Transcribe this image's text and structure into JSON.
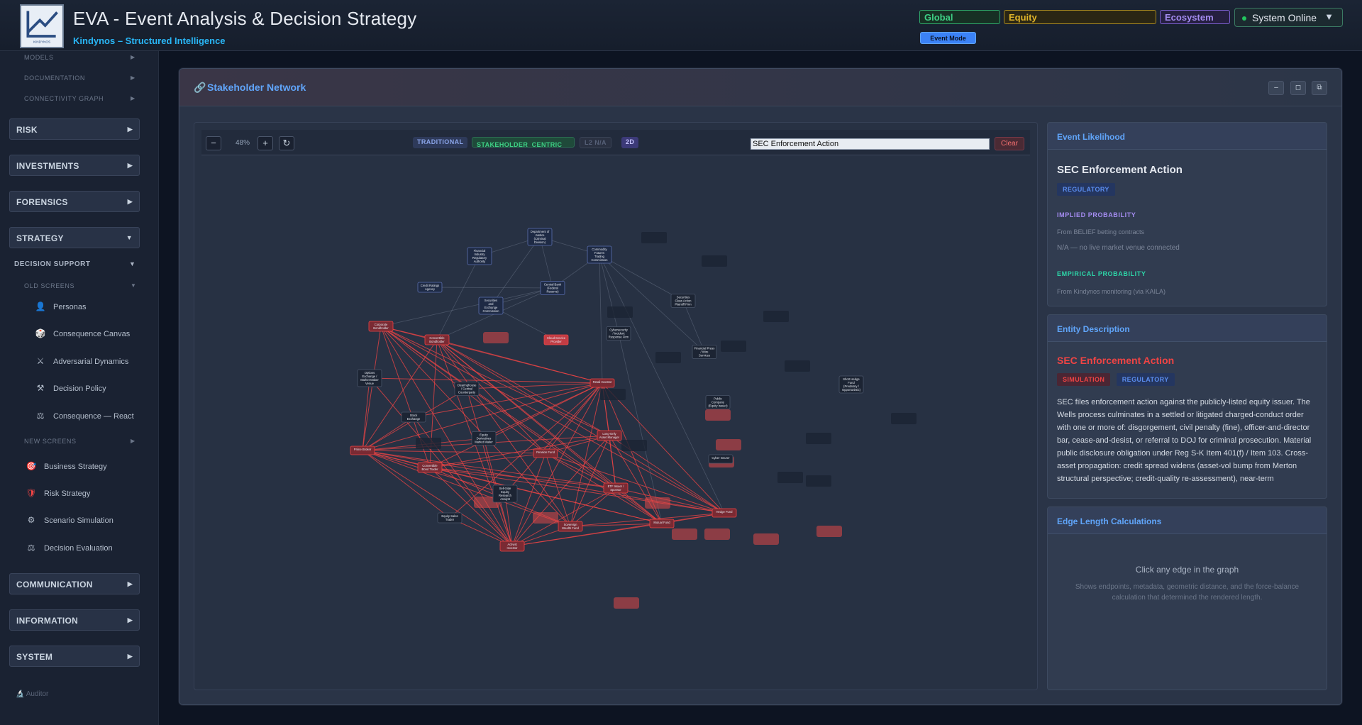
{
  "header": {
    "title": "EVA - Event Analysis & Decision Strategy",
    "subtitle": "Kindynos – Structured Intelligence",
    "logo_text": "KINDYNOS",
    "scope_global": "Global",
    "scope_equity": "Equity",
    "scope_ecosystem": "Ecosystem",
    "status": "System Online",
    "event_mode": "Event Mode"
  },
  "sidebar": {
    "top_items": [
      "MODELS",
      "DOCUMENTATION",
      "CONNECTIVITY GRAPH"
    ],
    "sections": {
      "risk": "RISK",
      "investments": "INVESTMENTS",
      "forensics": "FORENSICS",
      "strategy": "STRATEGY",
      "communication": "COMMUNICATION",
      "information": "INFORMATION",
      "system": "SYSTEM"
    },
    "decision_support": "DECISION SUPPORT",
    "old_screens": "OLD SCREENS",
    "old_items": [
      "Personas",
      "Consequence Canvas",
      "Adversarial Dynamics",
      "Decision Policy",
      "Consequence — React"
    ],
    "new_screens": "NEW SCREENS",
    "new_items": [
      "Business Strategy",
      "Risk Strategy",
      "Scenario Simulation",
      "Decision Evaluation"
    ],
    "footer": "Auditor"
  },
  "panel": {
    "title": "Stakeholder Network",
    "toolbar": {
      "zoom": "48%",
      "mode_traditional": "TRADITIONAL",
      "mode_stakeholder": "STAKEHOLDER_CENTRIC",
      "mode_l2": "L2 N/A",
      "mode_2d": "2D",
      "search_value": "SEC Enforcement Action",
      "clear": "Clear"
    }
  },
  "graph": {
    "nodes": [
      {
        "id": "doj",
        "label": [
          "Department of",
          "Justice",
          "(Criminal",
          "Division)"
        ],
        "tier": "blue"
      },
      {
        "id": "finra",
        "label": [
          "Financial",
          "Industry",
          "Regulatory",
          "Authority"
        ],
        "tier": "blue"
      },
      {
        "id": "cftc",
        "label": [
          "Commodity",
          "Futures",
          "Trading",
          "Commission"
        ],
        "tier": "blue"
      },
      {
        "id": "cra",
        "label": [
          "Credit Ratings",
          "Agency"
        ],
        "tier": "blue"
      },
      {
        "id": "cb",
        "label": [
          "Central Bank",
          "(Federal",
          "Reserve)"
        ],
        "tier": "blue"
      },
      {
        "id": "sec",
        "label": [
          "Securities",
          "and",
          "Exchange",
          "Commission"
        ],
        "tier": "blue"
      },
      {
        "id": "scapf",
        "label": [
          "Securities",
          "Class Action",
          "Plaintiff Firm"
        ],
        "tier": "dark"
      },
      {
        "id": "cirf",
        "label": [
          "Cybersecurity",
          "/ Incident",
          "Response Firm"
        ],
        "tier": "dark"
      },
      {
        "id": "fpws",
        "label": [
          "Financial Press",
          "/ Wire",
          "Services"
        ],
        "tier": "dark"
      },
      {
        "id": "corpbh",
        "label": [
          "Corporate",
          "Bondholder"
        ],
        "tier": "red"
      },
      {
        "id": "convbh",
        "label": [
          "Convertible",
          "Bondholder"
        ],
        "tier": "red"
      },
      {
        "id": "csp",
        "label": [
          "Cloud Service",
          "Provider"
        ],
        "tier": "redblob"
      },
      {
        "id": "retail",
        "label": [
          "Retail Investor"
        ],
        "tier": "red"
      },
      {
        "id": "oemm",
        "label": [
          "Options",
          "Exchange /",
          "Market Maker",
          "Venue"
        ],
        "tier": "dark"
      },
      {
        "id": "ccp",
        "label": [
          "Clearinghouse",
          "/ Central",
          "Counterparty"
        ],
        "tier": "dark"
      },
      {
        "id": "pci",
        "label": [
          "Public",
          "Company",
          "(Equity Issuer)"
        ],
        "tier": "dark"
      },
      {
        "id": "sfhf",
        "label": [
          "Short Hedge",
          "Fund",
          "(Predatory /",
          "Opportunistic)"
        ],
        "tier": "dark"
      },
      {
        "id": "sx",
        "label": [
          "Stock",
          "Exchange"
        ],
        "tier": "dark"
      },
      {
        "id": "edmm",
        "label": [
          "Equity",
          "Derivatives",
          "Market Maker"
        ],
        "tier": "dark"
      },
      {
        "id": "lopm",
        "label": [
          "Long-Only",
          "Asset Manager"
        ],
        "tier": "red"
      },
      {
        "id": "pb",
        "label": [
          "Prime Broker"
        ],
        "tier": "red"
      },
      {
        "id": "pf",
        "label": [
          "Pension Fund"
        ],
        "tier": "red"
      },
      {
        "id": "cbt",
        "label": [
          "Convertible",
          "Bond Trader"
        ],
        "tier": "red"
      },
      {
        "id": "ci",
        "label": [
          "Cyber Insurer"
        ],
        "tier": "dark"
      },
      {
        "id": "ssera",
        "label": [
          "Sell-Side",
          "Equity",
          "Research",
          "Analyst"
        ],
        "tier": "dark"
      },
      {
        "id": "etf",
        "label": [
          "ETF Issuer /",
          "Sponsor"
        ],
        "tier": "red"
      },
      {
        "id": "est",
        "label": [
          "Equity Sales",
          "Trader"
        ],
        "tier": "dark"
      },
      {
        "id": "swf",
        "label": [
          "Sovereign",
          "Wealth Fund"
        ],
        "tier": "red"
      },
      {
        "id": "mf",
        "label": [
          "Mutual Fund"
        ],
        "tier": "red"
      },
      {
        "id": "hf",
        "label": [
          "Hedge Fund"
        ],
        "tier": "red"
      },
      {
        "id": "ai",
        "label": [
          "Activist",
          "Investor"
        ],
        "tier": "red"
      }
    ]
  },
  "likelihood": {
    "heading": "Event Likelihood",
    "event": "SEC Enforcement Action",
    "badge": "REGULATORY",
    "implied_label": "IMPLIED PROBABILITY",
    "implied_source": "From BELIEF betting contracts",
    "implied_value": "N/A — no live market venue connected",
    "empirical_label": "EMPIRICAL PROBABILITY",
    "empirical_source": "From Kindynos monitoring (via KAILA)"
  },
  "entity": {
    "heading": "Entity Description",
    "name": "SEC Enforcement Action",
    "badge_sim": "SIMULATION",
    "badge_reg": "REGULATORY",
    "description": "SEC files enforcement action against the publicly-listed equity issuer. The Wells process culminates in a settled or litigated charged-conduct order with one or more of: disgorgement, civil penalty (fine), officer-and-director bar, cease-and-desist, or referral to DOJ for criminal prosecution. Material public disclosure obligation under Reg S-K Item 401(f) / Item 103. Cross-asset propagation: credit spread widens (asset-vol bump from Merton structural perspective; credit-quality re-assessment), near-term"
  },
  "edges_panel": {
    "heading": "Edge Length Calculations",
    "prompt": "Click any edge in the graph",
    "hint": "Shows endpoints, metadata, geometric distance, and the force-balance calculation that determined the rendered length."
  },
  "colors": {
    "accent_blue": "#60a5fa",
    "edge_red": "#ef4444",
    "regulatory": "#5b8def",
    "simulation": "#ef4444",
    "online": "#22c55e"
  }
}
